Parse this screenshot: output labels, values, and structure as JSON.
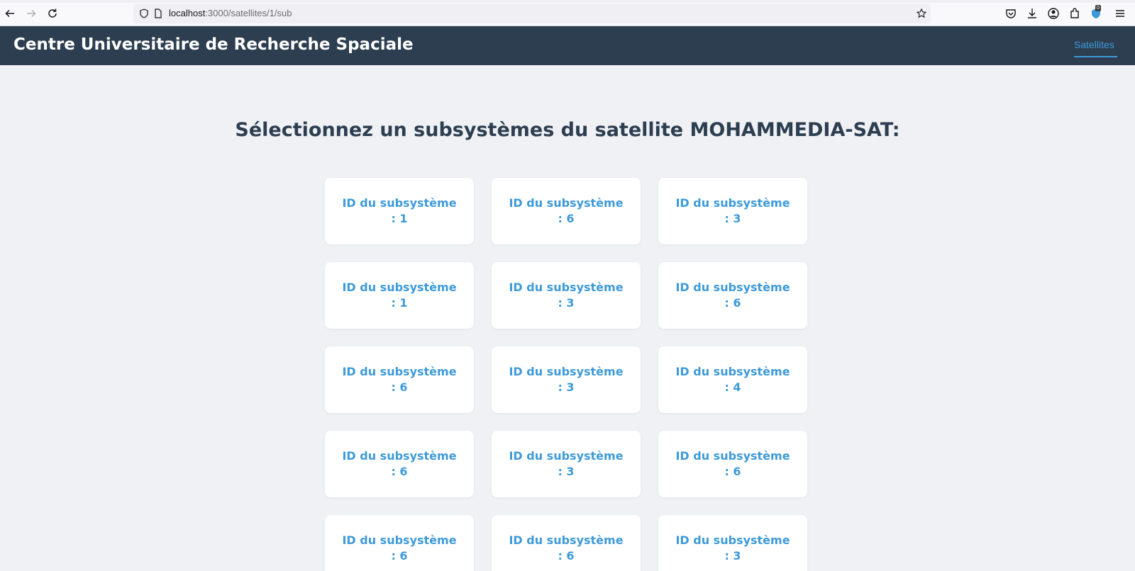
{
  "browser": {
    "url_host": "localhost",
    "url_path": ":3000/satellites/1/sub",
    "badge_count": "0"
  },
  "header": {
    "title": "Centre Universitaire de Recherche Spaciale",
    "nav_link": "Satellites"
  },
  "main": {
    "heading": "Sélectionnez un subsystèmes du satellite MOHAMMEDIA-SAT:",
    "card_label": "ID du subsystème",
    "cards": [
      {
        "id": ": 1"
      },
      {
        "id": ": 6"
      },
      {
        "id": ": 3"
      },
      {
        "id": ": 1"
      },
      {
        "id": ": 3"
      },
      {
        "id": ": 6"
      },
      {
        "id": ": 6"
      },
      {
        "id": ": 3"
      },
      {
        "id": ": 4"
      },
      {
        "id": ": 6"
      },
      {
        "id": ": 3"
      },
      {
        "id": ": 6"
      },
      {
        "id": ": 6"
      },
      {
        "id": ": 6"
      },
      {
        "id": ": 3"
      }
    ]
  },
  "colors": {
    "header_bg": "#2d3e50",
    "accent": "#3d9ad9",
    "page_bg": "#eff1f5"
  }
}
